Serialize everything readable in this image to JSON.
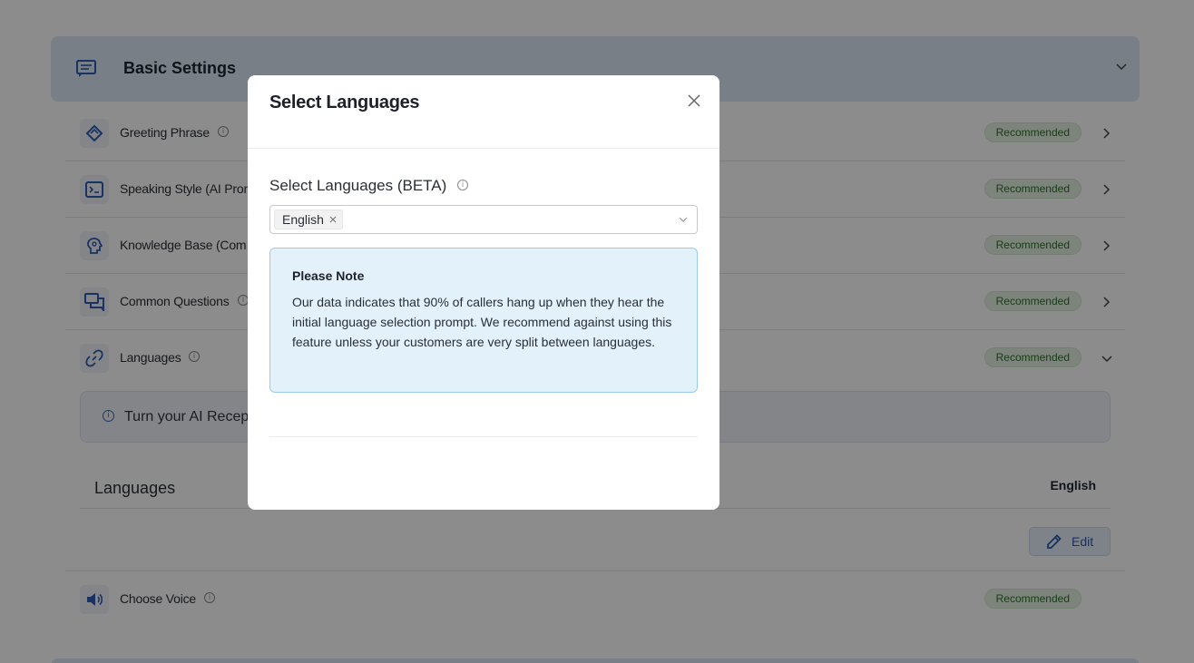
{
  "section": {
    "title": "Basic Settings"
  },
  "rows": [
    {
      "label": "Greeting Phrase",
      "badge": "Recommended"
    },
    {
      "label": "Speaking Style (AI Pron",
      "badge": "Recommended"
    },
    {
      "label": "Knowledge Base (Com",
      "badge": "Recommended"
    },
    {
      "label": "Common Questions",
      "badge": "Recommended"
    },
    {
      "label": "Languages",
      "badge": "Recommended"
    }
  ],
  "info_banner": {
    "text": "Turn your AI Recep"
  },
  "languages_panel": {
    "title": "Languages",
    "value": "English",
    "edit_label": "Edit"
  },
  "voice_row": {
    "label": "Choose Voice",
    "badge": "Recommended"
  },
  "modal": {
    "title": "Select Languages",
    "field_label": "Select Languages (BETA)",
    "selected_tags": [
      "English"
    ],
    "note_title": "Please Note",
    "note_body": "Our data indicates that 90% of callers hang up when they hear the initial language selection prompt. We recommend against using this feature unless your customers are very split between languages."
  },
  "colors": {
    "accent": "#2e5bb3",
    "badge_bg": "#e3f1e2",
    "badge_text": "#2f6d2a",
    "note_bg": "#e3f1fb",
    "note_border": "#9dcbee"
  }
}
